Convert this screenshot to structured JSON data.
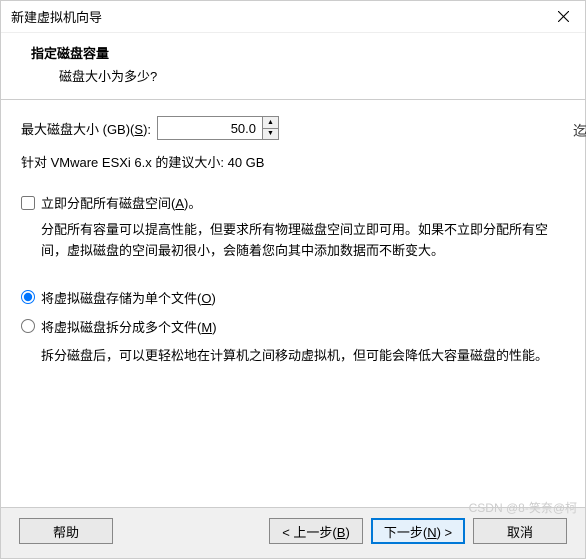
{
  "window": {
    "title": "新建虚拟机向导"
  },
  "header": {
    "title": "指定磁盘容量",
    "subtitle": "磁盘大小为多少?"
  },
  "size": {
    "label": "最大磁盘大小 (GB)(",
    "hotkey": "S",
    "label_suffix": "):",
    "value": "50.0",
    "recommend": "针对 VMware ESXi 6.x 的建议大小: 40 GB"
  },
  "allocate": {
    "label_pre": "立即分配所有磁盘空间(",
    "hotkey": "A",
    "label_post": ")。",
    "desc": "分配所有容量可以提高性能，但要求所有物理磁盘空间立即可用。如果不立即分配所有空间，虚拟磁盘的空间最初很小，会随着您向其中添加数据而不断变大。"
  },
  "store": {
    "single_pre": "将虚拟磁盘存储为单个文件(",
    "single_hot": "O",
    "single_post": ")",
    "split_pre": "将虚拟磁盘拆分成多个文件(",
    "split_hot": "M",
    "split_post": ")",
    "split_desc": "拆分磁盘后，可以更轻松地在计算机之间移动虚拟机，但可能会降低大容量磁盘的性能。"
  },
  "footer": {
    "help": "帮助",
    "back_pre": "< 上一步(",
    "back_hot": "B",
    "back_post": ")",
    "next_pre": "下一步(",
    "next_hot": "N",
    "next_post": ") >",
    "cancel": "取消"
  },
  "watermark": "CSDN @8-笑奈@柯",
  "side": "迄"
}
